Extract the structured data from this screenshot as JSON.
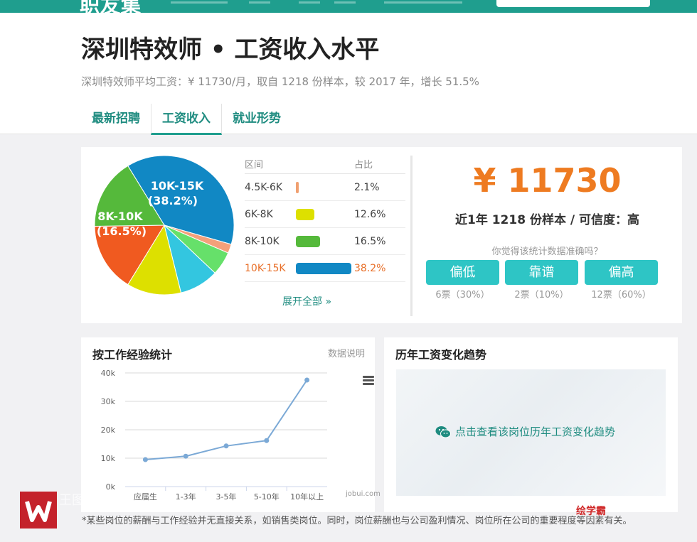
{
  "topnav": {
    "logo": "职友集"
  },
  "header": {
    "title": "深圳特效师 • 工资收入水平",
    "subtitle": "深圳特效师平均工资：¥ 11730/月，取自 1218 份样本，较 2017 年，增长 51.5%",
    "tabs": [
      {
        "label": "最新招聘",
        "active": false
      },
      {
        "label": "工资收入",
        "active": true
      },
      {
        "label": "就业形势",
        "active": false
      }
    ]
  },
  "distribution": {
    "header_range": "区间",
    "header_ratio": "占比",
    "rows": [
      {
        "range": "4.5K-6K",
        "percent": "2.1%",
        "value": 2.1,
        "color": "#f0a070"
      },
      {
        "range": "6K-8K",
        "percent": "12.6%",
        "value": 12.6,
        "color": "#dde000"
      },
      {
        "range": "8K-10K",
        "percent": "16.5%",
        "value": 16.5,
        "color": "#55b93b"
      },
      {
        "range": "10K-15K",
        "percent": "38.2%",
        "value": 38.2,
        "color": "#1188c4",
        "highlight": true
      }
    ],
    "expand_label": "展开全部 »",
    "pie_labels": [
      {
        "line1": "10K-15K",
        "line2": "(38.2%)"
      },
      {
        "line1": "8K-10K",
        "line2": "(16.5%)"
      }
    ]
  },
  "chart_data": {
    "type": "pie",
    "slices": [
      {
        "label": "10K-15K",
        "value": 38.2,
        "color": "#1188c4"
      },
      {
        "label": "",
        "value": 2.1,
        "color": "#f4a07a"
      },
      {
        "label": "",
        "value": 5.5,
        "color": "#66e06a"
      },
      {
        "label": "",
        "value": 9.1,
        "color": "#33c6e0"
      },
      {
        "label": "6K-8K",
        "value": 12.6,
        "color": "#dde000"
      },
      {
        "label": "",
        "value": 16.0,
        "color": "#f05a20"
      },
      {
        "label": "8K-10K",
        "value": 16.5,
        "color": "#55b93b"
      }
    ]
  },
  "summary": {
    "salary": "¥ 11730",
    "sample_line": "近1年 1218 份样本 / 可信度：高",
    "ask": "你觉得该统计数据准确吗？",
    "votes": [
      {
        "label": "偏低",
        "count": "6票（30%）"
      },
      {
        "label": "靠谱",
        "count": "2票（10%）"
      },
      {
        "label": "偏高",
        "count": "12票（60%）"
      }
    ]
  },
  "experience": {
    "title": "按工作经验统计",
    "data_note": "数据说明",
    "credit": "jobui.com",
    "y_ticks": [
      "0k",
      "10k",
      "20k",
      "30k",
      "40k"
    ],
    "y_max": 40,
    "categories": [
      "应届生",
      "1-3年",
      "3-5年",
      "5-10年",
      "10年以上"
    ],
    "values": [
      9.5,
      10.7,
      14.3,
      16.2,
      37.5
    ],
    "line_color": "#7ba9d6"
  },
  "trend": {
    "title": "历年工资变化趋势",
    "link": "点击查看该岗位历年工资变化趋势"
  },
  "footnote": "*某些岗位的薪酬与工作经验并无直接关系，如销售类岗位。同时，岗位薪酬也与公司盈利情况、岗位所在公司的重要程度等因素有关。",
  "watermark": {
    "name": "王图",
    "brand": "绘学霸"
  }
}
